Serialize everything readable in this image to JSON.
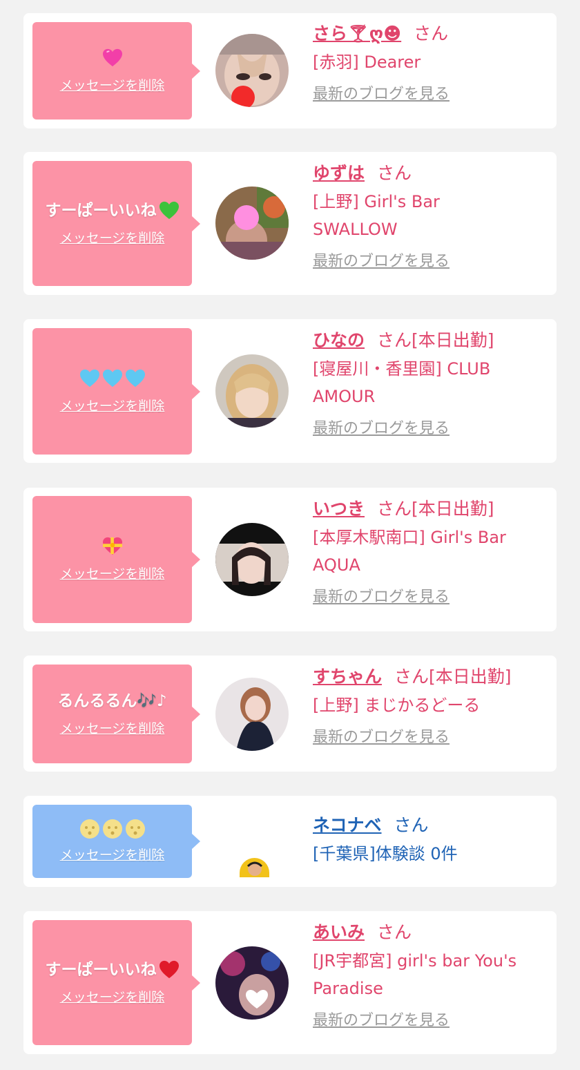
{
  "entries": [
    {
      "message": "",
      "message_emoji": "pink-sparkle-heart",
      "delete_label": "メッセージを削除",
      "name": "さら🍸︎ღ☻",
      "honorific": "さん",
      "status": "",
      "shop_line1": "[赤羽] Dearer",
      "shop_line2": "",
      "blog_link": "最新のブログを見る",
      "bubble_color": "#fc93a6"
    },
    {
      "message": "すーぱーいいね",
      "message_emoji": "green-heart",
      "delete_label": "メッセージを削除",
      "name": "ゆずは",
      "honorific": "さん",
      "status": "",
      "shop_line1": "[上野] Girl's Bar",
      "shop_line2": "SWALLOW",
      "blog_link": "最新のブログを見る",
      "bubble_color": "#fc93a6"
    },
    {
      "message": "",
      "message_emoji": "three-light-blue-hearts",
      "delete_label": "メッセージを削除",
      "name": "ひなの",
      "honorific": "さん",
      "status": "[本日出勤]",
      "shop_line1": "[寝屋川・香里園] CLUB",
      "shop_line2": "AMOUR",
      "blog_link": "最新のブログを見る",
      "bubble_color": "#fc93a6"
    },
    {
      "message": "",
      "message_emoji": "heart-with-ribbon",
      "delete_label": "メッセージを削除",
      "name": "いつき",
      "honorific": "さん",
      "status": "[本日出勤]",
      "shop_line1": "[本厚木駅南口] Girl's Bar",
      "shop_line2": "AQUA",
      "blog_link": "最新のブログを見る",
      "bubble_color": "#fc93a6"
    },
    {
      "message": "るんるるん🎶♪",
      "message_emoji": "",
      "delete_label": "メッセージを削除",
      "name": "すちゃん",
      "honorific": "さん",
      "status": "[本日出勤]",
      "shop_line1": "[上野] まじかるどーる",
      "shop_line2": "",
      "blog_link": "最新のブログを見る",
      "bubble_color": "#fc93a6"
    },
    {
      "message": "",
      "message_emoji": "three-moon-faces",
      "delete_label": "メッセージを削除",
      "name": "ネコナベ",
      "honorific": "さん",
      "status": "",
      "shop_line1": "[千葉県]体験談 0件",
      "shop_line2": "",
      "blog_link": "",
      "bubble_color": "#8ebcf6"
    },
    {
      "message": "すーぱーいいね",
      "message_emoji": "red-heart",
      "delete_label": "メッセージを削除",
      "name": "あいみ",
      "honorific": "さん",
      "status": "",
      "shop_line1": "[JR宇都宮] girl's bar You's",
      "shop_line2": "Paradise",
      "blog_link": "最新のブログを見る",
      "bubble_color": "#fc93a6"
    }
  ]
}
